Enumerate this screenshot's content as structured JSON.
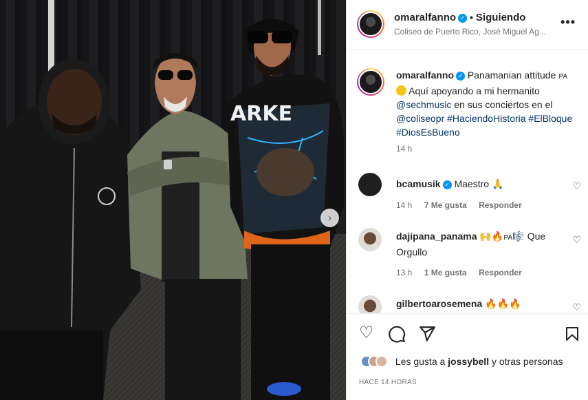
{
  "post": {
    "username": "omaralfanno",
    "follow_status": "Siguiendo",
    "location": "Coliseo de Puerto Rico, José Miguel Ag...",
    "more_label": "•••"
  },
  "caption": {
    "username": "omaralfanno",
    "text_1": "Panamanian attitude",
    "flag_1": "PA",
    "text_2": "Aquí apoyando a mi hermanito",
    "mention_1": "@sechmusic",
    "text_3": "en sus conciertos en el",
    "mention_2": "@coliseopr",
    "hashtags_1": "#HaciendoHistoria #ElBloque",
    "hashtags_2": "#DiosEsBueno",
    "time": "14 h"
  },
  "comments": [
    {
      "username": "bcamusik",
      "text": "Maestro 🙏",
      "time": "14 h",
      "likes": "7 Me gusta",
      "reply": "Responder"
    },
    {
      "username": "dajipana_panama",
      "text_emoji": "🙌🔥",
      "flag": "PA",
      "text_tail": "🎼 Que",
      "text_line2": "Orgullo",
      "time": "13 h",
      "likes": "1 Me gusta",
      "reply": "Responder"
    },
    {
      "username": "gilbertoarosemena",
      "text": "🔥🔥🔥"
    }
  ],
  "actions": {
    "like_icon": "heart-icon",
    "comment_icon": "comment-icon",
    "share_icon": "share-icon",
    "save_icon": "bookmark-icon"
  },
  "likes": {
    "prefix": "Les gusta a",
    "user": "jossybell",
    "suffix": "y otras personas"
  },
  "timestamp": "HACE 14 HORAS",
  "colors": {
    "link": "#00376b",
    "verified": "#0095f6",
    "muted": "#737373"
  }
}
